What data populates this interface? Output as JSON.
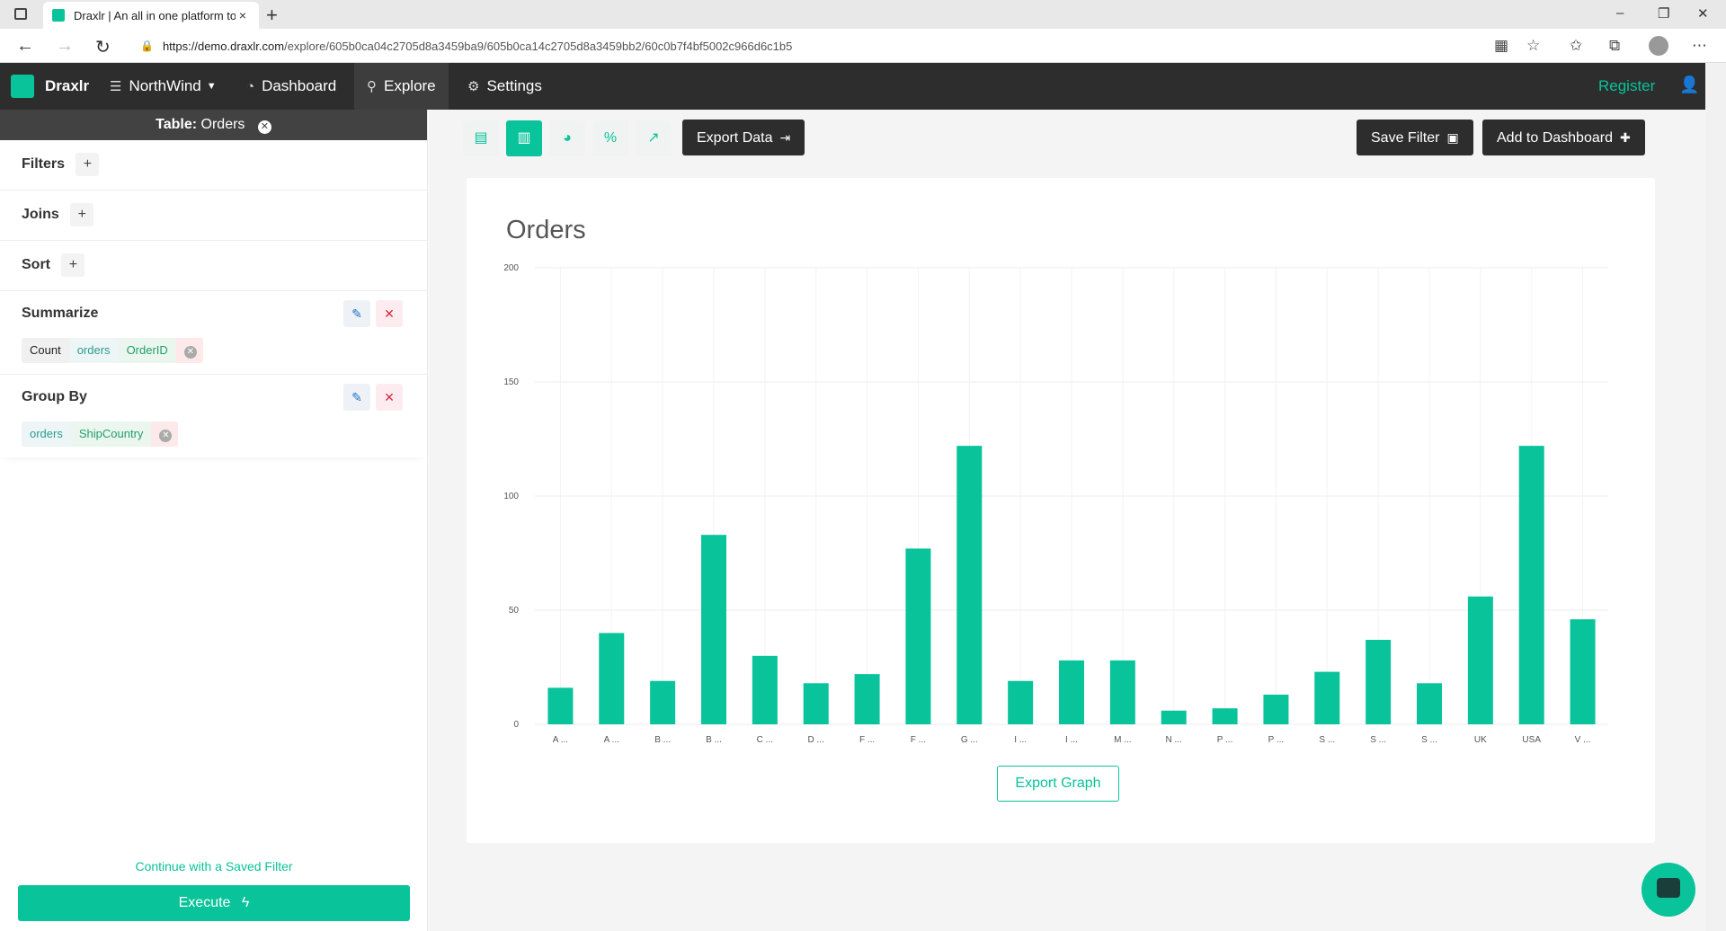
{
  "browser": {
    "tab_title": "Draxlr | An all in one platform to",
    "tab_close": "×",
    "new_tab": "+",
    "url_host": "https://demo.draxlr.com",
    "url_path": "/explore/605b0ca04c2705d8a3459ba9/605b0ca14c2705d8a3459bb2/60c0b7f4bf5002c966d6c1b5",
    "minimize": "–",
    "maximize": "❐",
    "close": "✕",
    "back": "←",
    "forward": "→",
    "reload": "↻"
  },
  "nav": {
    "brand": "Draxlr",
    "database": "NorthWind",
    "dashboard": "Dashboard",
    "explore": "Explore",
    "settings": "Settings",
    "register": "Register"
  },
  "sidebar": {
    "table_prefix": "Table:",
    "table_name": "Orders",
    "filters": "Filters",
    "joins": "Joins",
    "sort": "Sort",
    "summarize": "Summarize",
    "summarize_pill": {
      "agg": "Count",
      "table": "orders",
      "column": "OrderID"
    },
    "group_by": "Group By",
    "group_pill": {
      "table": "orders",
      "column": "ShipCountry"
    },
    "saved_filter_link": "Continue with a Saved Filter",
    "execute": "Execute"
  },
  "toolbar": {
    "export_data": "Export Data",
    "save_filter": "Save Filter",
    "add_to_dashboard": "Add to Dashboard"
  },
  "export_graph": "Export Graph",
  "colors": {
    "accent": "#09c39a",
    "dark": "#2d2d2d"
  },
  "chart_data": {
    "type": "bar",
    "title": "Orders",
    "categories": [
      "A ...",
      "A ...",
      "B ...",
      "B ...",
      "C ...",
      "D ...",
      "F ...",
      "F ...",
      "G ...",
      "I ...",
      "I ...",
      "M ...",
      "N ...",
      "P ...",
      "P ...",
      "S ...",
      "S ...",
      "S ...",
      "UK",
      "USA",
      "V ..."
    ],
    "values": [
      16,
      40,
      19,
      83,
      30,
      18,
      22,
      77,
      122,
      19,
      28,
      28,
      6,
      7,
      13,
      23,
      37,
      18,
      56,
      122,
      46
    ],
    "y_ticks": [
      0,
      50,
      100,
      150,
      200
    ],
    "ylim": [
      0,
      200
    ],
    "grid": true
  }
}
